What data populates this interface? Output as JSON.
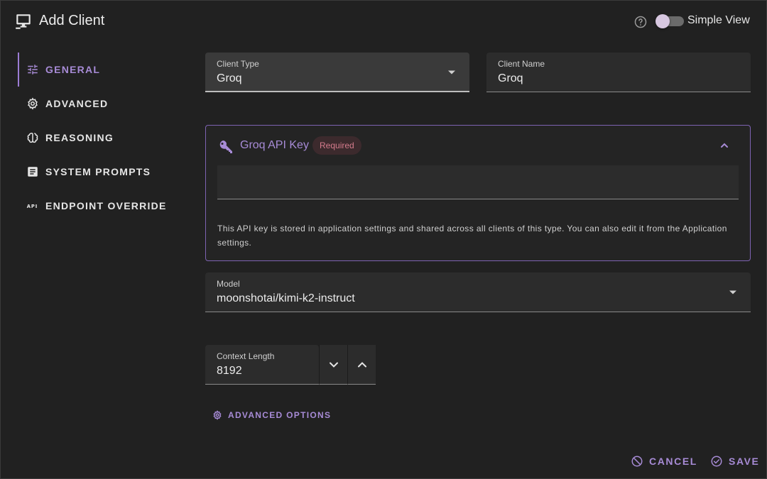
{
  "dialog": {
    "title": "Add Client",
    "simple_view_label": "Simple View",
    "simple_view_on": false
  },
  "sidebar": {
    "items": [
      {
        "label": "General",
        "icon": "tune-icon",
        "active": true
      },
      {
        "label": "Advanced",
        "icon": "gear-icon",
        "active": false
      },
      {
        "label": "Reasoning",
        "icon": "brain-icon",
        "active": false
      },
      {
        "label": "System Prompts",
        "icon": "text-box-icon",
        "active": false
      },
      {
        "label": "Endpoint Override",
        "icon": "api-icon",
        "active": false
      }
    ]
  },
  "form": {
    "client_type": {
      "label": "Client Type",
      "value": "Groq"
    },
    "client_name": {
      "label": "Client Name",
      "value": "Groq"
    },
    "api_key": {
      "title": "Groq API Key",
      "badge": "Required",
      "value": "",
      "hint": "This API key is stored in application settings and shared across all clients of this type. You can also edit it from the Application settings."
    },
    "model": {
      "label": "Model",
      "value": "moonshotai/kimi-k2-instruct"
    },
    "context_length": {
      "label": "Context Length",
      "value": "8192"
    },
    "advanced_options_label": "Advanced Options"
  },
  "footer": {
    "cancel_label": "Cancel",
    "save_label": "Save"
  },
  "colors": {
    "accent": "#a78bd6",
    "badge_text": "#d47b8c",
    "background": "#212121"
  }
}
